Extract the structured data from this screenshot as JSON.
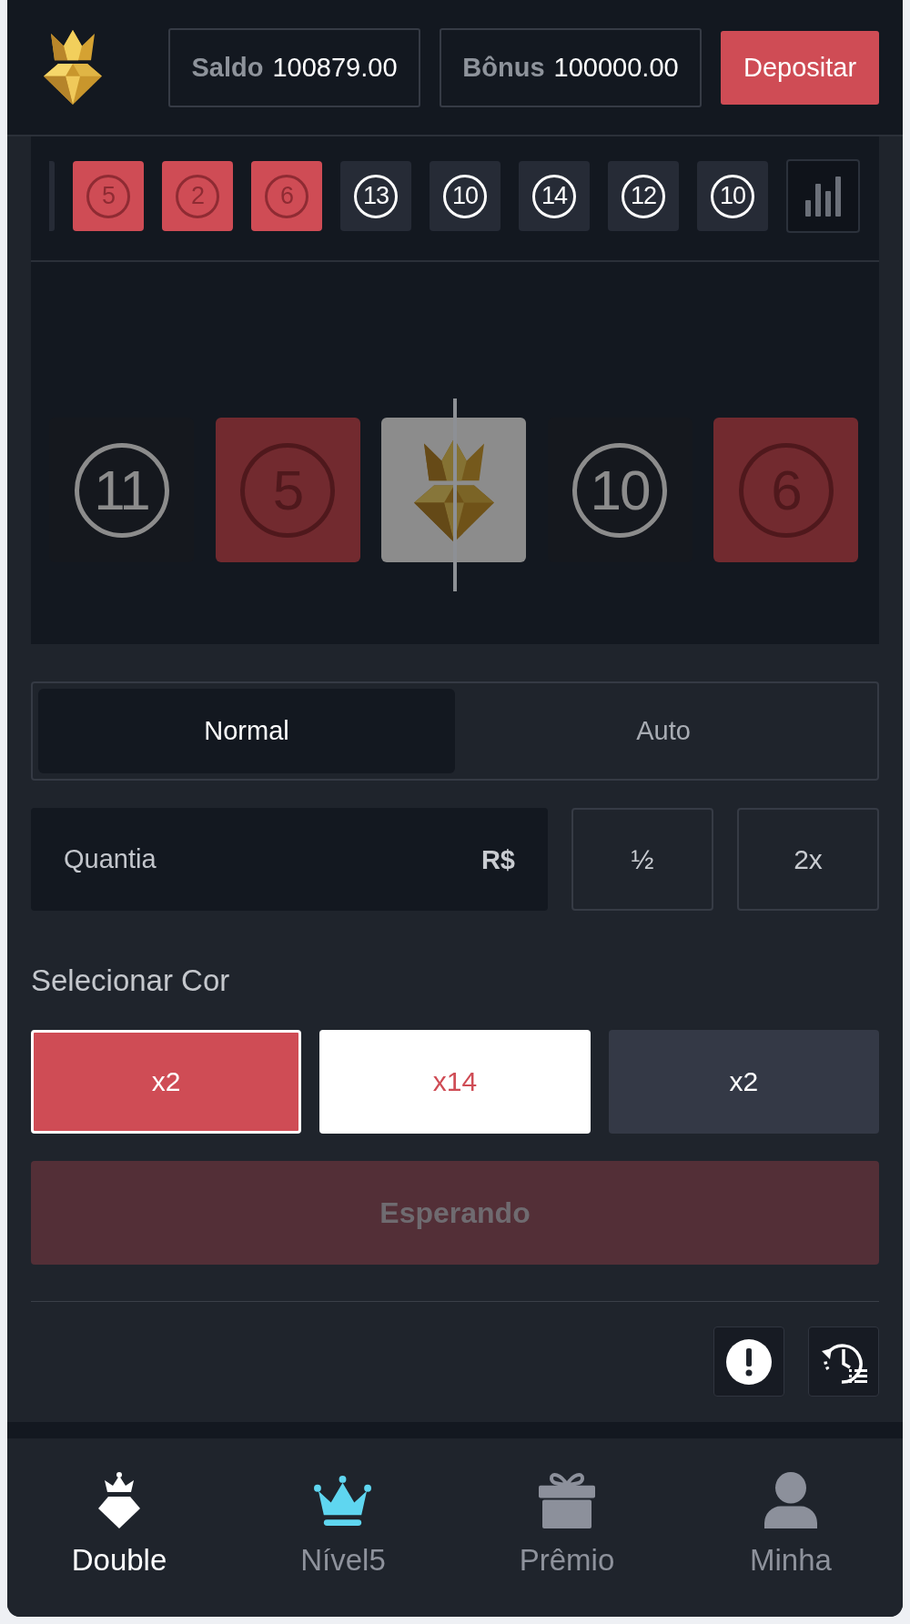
{
  "header": {
    "balance": {
      "label": "Saldo",
      "value": "100879.00"
    },
    "bonus": {
      "label": "Bônus",
      "value": "100000.00"
    },
    "deposit_button": "Depositar"
  },
  "history": [
    {
      "kind": "black",
      "cut_off": true
    },
    {
      "kind": "red",
      "number": "5",
      "cut_off": false
    },
    {
      "kind": "red",
      "number": "2",
      "cut_off": false
    },
    {
      "kind": "red",
      "number": "6",
      "cut_off": false
    },
    {
      "kind": "black",
      "number": "13",
      "cut_off": false
    },
    {
      "kind": "black",
      "number": "10",
      "cut_off": false
    },
    {
      "kind": "black",
      "number": "14",
      "cut_off": false
    },
    {
      "kind": "black",
      "number": "12",
      "cut_off": false
    },
    {
      "kind": "black",
      "number": "10",
      "cut_off": false
    }
  ],
  "reel": {
    "dimmed": true,
    "tiles": [
      {
        "kind": "black",
        "number": "11"
      },
      {
        "kind": "red",
        "number": "5"
      },
      {
        "kind": "white"
      },
      {
        "kind": "black",
        "number": "10"
      },
      {
        "kind": "red",
        "number": "6"
      }
    ]
  },
  "mode_tabs": [
    {
      "label": "Normal",
      "selected": true
    },
    {
      "label": "Auto",
      "selected": false
    }
  ],
  "amount": {
    "placeholder": "Quantia",
    "currency": "R$",
    "buttons": [
      "½",
      "2x"
    ]
  },
  "color_select": {
    "title": "Selecionar Cor",
    "options": [
      {
        "kind": "red",
        "label": "x2",
        "selected": true
      },
      {
        "kind": "white",
        "label": "x14",
        "selected": false
      },
      {
        "kind": "black",
        "label": "x2",
        "selected": false
      }
    ]
  },
  "bet_button": {
    "label": "Esperando",
    "disabled": true
  },
  "nav": [
    {
      "kind": "double",
      "label": "Double",
      "selected": true
    },
    {
      "kind": "level",
      "label": "Nível5",
      "selected": false
    },
    {
      "kind": "prize",
      "label": "Prêmio",
      "selected": false
    },
    {
      "kind": "profile",
      "label": "Minha",
      "selected": false
    }
  ]
}
